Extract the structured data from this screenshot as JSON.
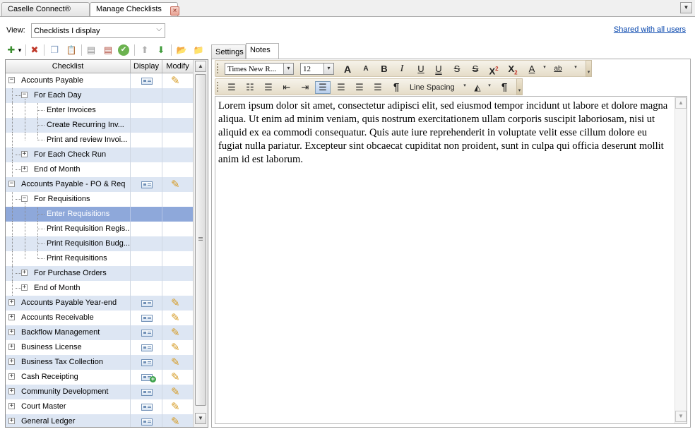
{
  "tabs": [
    {
      "label": "Caselle Connect®",
      "active": false
    },
    {
      "label": "Manage Checklists",
      "active": true,
      "close_glyph": "×"
    }
  ],
  "tab_menu_glyph": "▼",
  "view": {
    "label": "View:",
    "selected": "Checklists I display",
    "chevron": "⌵"
  },
  "shared_link": "Shared with all users",
  "toolbar": {
    "new": "✚",
    "new_drop": "▾",
    "delete": "✖",
    "copy": "❐",
    "paste": "📋",
    "hide": "▤",
    "hide_x": "▤",
    "approve": "✔",
    "up": "⬆",
    "down": "⬇",
    "folder_open": "📂",
    "folder_out": "📁"
  },
  "tree": {
    "headers": {
      "checklist": "Checklist",
      "display": "Display",
      "modify": "Modify"
    },
    "rows": [
      {
        "label": "Accounts Payable",
        "level": 0,
        "expander": "−",
        "display": true,
        "modify": true
      },
      {
        "label": "For Each Day",
        "level": 1,
        "expander": "−"
      },
      {
        "label": "Enter Invoices",
        "level": 2
      },
      {
        "label": "Create Recurring Inv...",
        "level": 2
      },
      {
        "label": "Print and review Invoi...",
        "level": 2
      },
      {
        "label": "For Each Check Run",
        "level": 1,
        "expander": "+"
      },
      {
        "label": "End of Month",
        "level": 1,
        "expander": "+"
      },
      {
        "label": "Accounts Payable - PO & Req",
        "level": 0,
        "expander": "−",
        "display": true,
        "modify": true
      },
      {
        "label": "For Requisitions",
        "level": 1,
        "expander": "−"
      },
      {
        "label": "Enter Requisitions",
        "level": 2,
        "selected": true
      },
      {
        "label": "Print Requisition Regis...",
        "level": 2
      },
      {
        "label": "Print Requisition Budg...",
        "level": 2
      },
      {
        "label": "Print Requisitions",
        "level": 2
      },
      {
        "label": "For Purchase Orders",
        "level": 1,
        "expander": "+"
      },
      {
        "label": "End of Month",
        "level": 1,
        "expander": "+"
      },
      {
        "label": "Accounts Payable Year-end",
        "level": 0,
        "expander": "+",
        "display": true,
        "modify": true
      },
      {
        "label": "Accounts Receivable",
        "level": 0,
        "expander": "+",
        "display": true,
        "modify": true
      },
      {
        "label": "Backflow Management",
        "level": 0,
        "expander": "+",
        "display": true,
        "modify": true
      },
      {
        "label": "Business License",
        "level": 0,
        "expander": "+",
        "display": true,
        "modify": true
      },
      {
        "label": "Business Tax Collection",
        "level": 0,
        "expander": "+",
        "display": true,
        "modify": true
      },
      {
        "label": "Cash Receipting",
        "level": 0,
        "expander": "+",
        "display": true,
        "display_add": true,
        "modify": true
      },
      {
        "label": "Community Development",
        "level": 0,
        "expander": "+",
        "display": true,
        "modify": true
      },
      {
        "label": "Court Master",
        "level": 0,
        "expander": "+",
        "display": true,
        "modify": true
      },
      {
        "label": "General Ledger",
        "level": 0,
        "expander": "+",
        "display": true,
        "modify": true
      }
    ],
    "scroll_up": "▲",
    "scroll_down": "▼"
  },
  "right_tabs": [
    {
      "label": "Settings",
      "active": false
    },
    {
      "label": "Notes",
      "active": true
    }
  ],
  "format": {
    "font": "Times New R...",
    "size": "12",
    "combo_glyph": "▾",
    "grow": "A",
    "shrink": "A",
    "bold": "B",
    "italic": "I",
    "underline": "U",
    "double_underline": "U",
    "strike": "S",
    "double_strike": "S",
    "superscript": "X",
    "superscript_mark": "2",
    "subscript": "X",
    "subscript_mark": "2",
    "font_color": "A",
    "highlight": "ab",
    "bullets": "☰",
    "numbering": "☷",
    "multilevel": "☰",
    "outdent": "⇤",
    "indent": "⇥",
    "align_left": "☰",
    "align_center": "☰",
    "align_right": "☰",
    "justify": "☰",
    "pilcrow": "¶",
    "line_spacing": "Line Spacing",
    "paragraph_mark": "¶",
    "drop": "▾",
    "endcap": "▾"
  },
  "notes_text": "Lorem ipsum dolor sit amet, consectetur adipisci elit, sed eiusmod tempor incidunt ut labore et dolore magna aliqua. Ut enim ad minim veniam, quis nostrum exercitationem ullam corporis suscipit laboriosam, nisi ut aliquid ex ea commodi consequatur. Quis aute iure reprehenderit in voluptate velit esse cillum dolore eu fugiat nulla pariatur. Excepteur sint obcaecat cupiditat non proident, sunt in culpa qui officia deserunt mollit anim id est laborum.",
  "notes_scroll_up": "▲",
  "notes_scroll_down": "▼",
  "colors": {
    "row_alt": "#dde6f3",
    "row_selected": "#8ea8da",
    "link": "#0645ad",
    "format_bar": "#ece5d4",
    "active_button": "#b9cfed"
  }
}
